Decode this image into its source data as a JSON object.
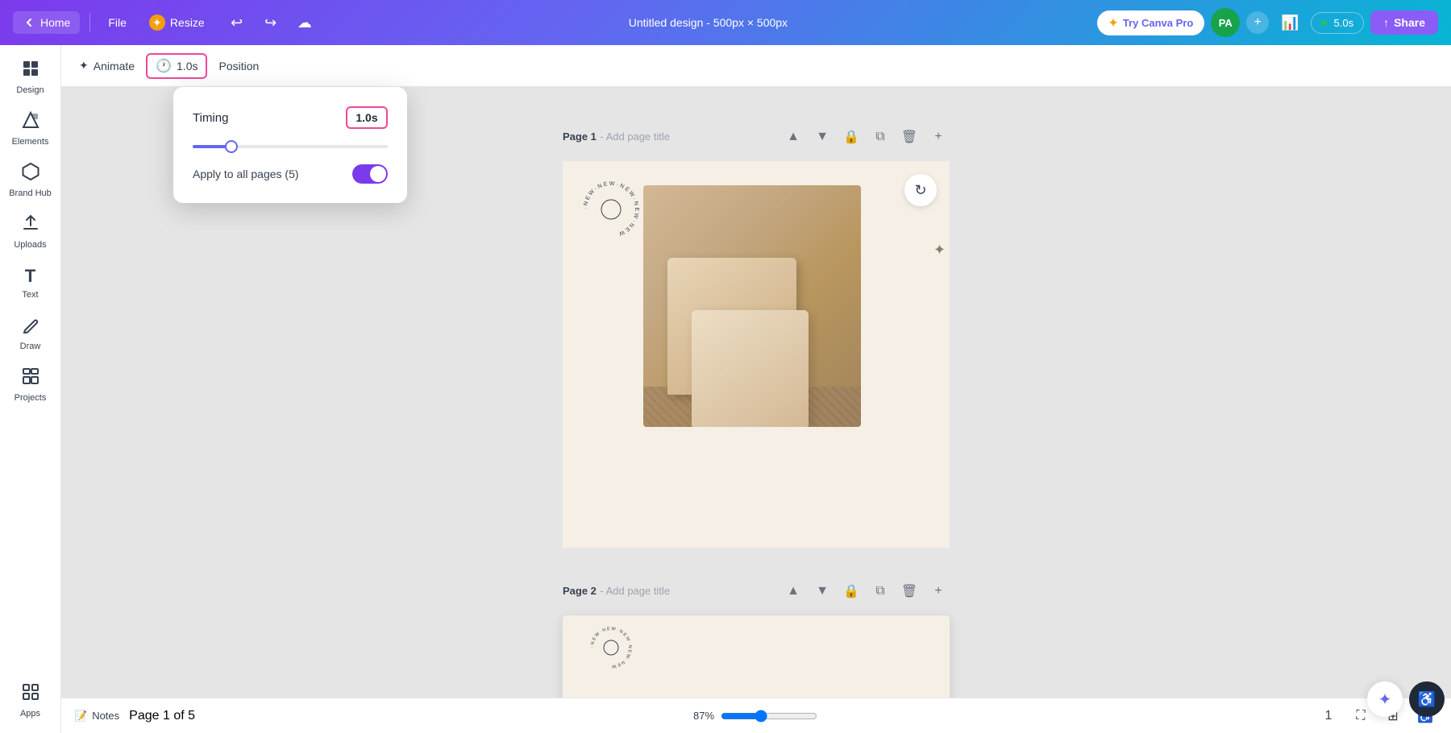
{
  "header": {
    "home_label": "Home",
    "file_label": "File",
    "resize_label": "Resize",
    "title": "Untitled design - 500px × 500px",
    "try_pro_label": "Try Canva Pro",
    "avatar_initials": "PA",
    "play_label": "5.0s",
    "share_label": "Share"
  },
  "sidebar": {
    "items": [
      {
        "id": "design",
        "label": "Design",
        "icon": "⊞"
      },
      {
        "id": "elements",
        "label": "Elements",
        "icon": "◇"
      },
      {
        "id": "brand-hub",
        "label": "Brand Hub",
        "icon": "⬡"
      },
      {
        "id": "uploads",
        "label": "Uploads",
        "icon": "↑"
      },
      {
        "id": "text",
        "label": "Text",
        "icon": "T"
      },
      {
        "id": "draw",
        "label": "Draw",
        "icon": "✏"
      },
      {
        "id": "projects",
        "label": "Projects",
        "icon": "▦"
      },
      {
        "id": "apps",
        "label": "Apps",
        "icon": "⊞"
      }
    ]
  },
  "toolbar": {
    "animate_label": "Animate",
    "timing_label": "1.0s",
    "position_label": "Position"
  },
  "timing_popup": {
    "title": "Timing",
    "value": "1.0s",
    "apply_label": "Apply to all pages (5)",
    "toggle_on": true
  },
  "canvas": {
    "page1_label": "Page 1",
    "page1_title_placeholder": "Add page title",
    "page2_label": "Page 2",
    "page2_title_placeholder": "Add page title",
    "refresh_icon": "↻"
  },
  "bottom_bar": {
    "notes_label": "Notes",
    "page_indicator": "Page 1 of 5",
    "zoom_level": "87%",
    "grid_number": "1"
  }
}
